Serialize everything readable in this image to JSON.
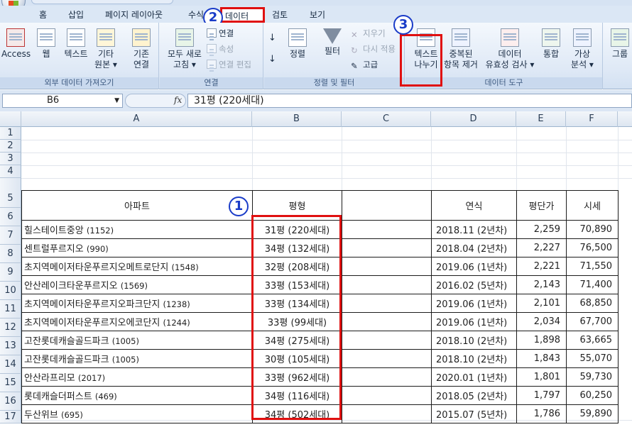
{
  "tabs": [
    {
      "label": "홈"
    },
    {
      "label": "삽입"
    },
    {
      "label": "페이지 레이아웃"
    },
    {
      "label": "수식"
    },
    {
      "label": "데이터"
    },
    {
      "label": "검토"
    },
    {
      "label": "보기"
    }
  ],
  "ribbon": {
    "external": {
      "label": "외부 데이터 가져오기",
      "access": "Access",
      "web": "웹",
      "text": "텍스트",
      "other1": "기타",
      "other2": "원본 ▾",
      "existing1": "기존",
      "existing2": "연결"
    },
    "connections": {
      "label": "연결",
      "refresh1": "모두 새로",
      "refresh2": "고침 ▾",
      "connections": "연결",
      "properties": "속성",
      "edit_links": "연결 편집"
    },
    "sort_filter": {
      "label": "정렬 및 필터",
      "sort": "정렬",
      "filter": "필터",
      "clear": "지우기",
      "reapply": "다시 적용",
      "advanced": "고급"
    },
    "data_tools": {
      "label": "데이터 도구",
      "text_to_columns1": "텍스트",
      "text_to_columns2": "나누기",
      "remove_dup1": "중복된",
      "remove_dup2": "항목 제거",
      "validation1": "데이터",
      "validation2": "유효성 검사 ▾",
      "consolidate": "통합",
      "whatif1": "가상",
      "whatif2": "분석 ▾"
    },
    "outline": {
      "group": "그룹"
    }
  },
  "annotations": {
    "n1": "1",
    "n2": "2",
    "n3": "3"
  },
  "formula_bar": {
    "name_box": "B6",
    "fx": "fx",
    "value": "31평 (220세대)"
  },
  "columns": [
    "A",
    "B",
    "C",
    "D",
    "E",
    "F"
  ],
  "rows": [
    "1",
    "2",
    "3",
    "4",
    "5",
    "6",
    "7",
    "8",
    "9",
    "10",
    "11",
    "12",
    "13",
    "14",
    "15",
    "16",
    "17"
  ],
  "table": {
    "headers": {
      "apt": "아파트",
      "size": "평형",
      "blank": "",
      "year": "연식",
      "price_per": "평단가",
      "market": "시세"
    },
    "rows": [
      {
        "apt": "힐스테이트중앙",
        "cnt": "(1152)",
        "size": "31평 (220세대)",
        "year": "2018.11 (2년차)",
        "price_per": "2,259",
        "market": "70,890"
      },
      {
        "apt": "센트럴푸르지오",
        "cnt": "(990)",
        "size": "34평 (132세대)",
        "year": "2018.04 (2년차)",
        "price_per": "2,227",
        "market": "76,500"
      },
      {
        "apt": "초지역메이저타운푸르지오메트로단지",
        "cnt": "(1548)",
        "size": "32평 (208세대)",
        "year": "2019.06 (1년차)",
        "price_per": "2,221",
        "market": "71,550"
      },
      {
        "apt": "안산레이크타운푸르지오",
        "cnt": "(1569)",
        "size": "33평 (153세대)",
        "year": "2016.02 (5년차)",
        "price_per": "2,143",
        "market": "71,400"
      },
      {
        "apt": "초지역메이저타운푸르지오파크단지",
        "cnt": "(1238)",
        "size": "33평 (134세대)",
        "year": "2019.06 (1년차)",
        "price_per": "2,101",
        "market": "68,850"
      },
      {
        "apt": "초지역메이저타운푸르지오에코단지",
        "cnt": "(1244)",
        "size": "33평 (99세대)",
        "year": "2019.06 (1년차)",
        "price_per": "2,034",
        "market": "67,700"
      },
      {
        "apt": "고잔롯데캐슬골드파크",
        "cnt": "(1005)",
        "size": "34평 (275세대)",
        "year": "2018.10 (2년차)",
        "price_per": "1,898",
        "market": "63,665"
      },
      {
        "apt": "고잔롯데캐슬골드파크",
        "cnt": "(1005)",
        "size": "30평 (105세대)",
        "year": "2018.10 (2년차)",
        "price_per": "1,843",
        "market": "55,070"
      },
      {
        "apt": "안산라프리모",
        "cnt": "(2017)",
        "size": "33평 (962세대)",
        "year": "2020.01 (1년차)",
        "price_per": "1,801",
        "market": "59,730"
      },
      {
        "apt": "롯데캐슬더퍼스트",
        "cnt": "(469)",
        "size": "34평 (116세대)",
        "year": "2018.05 (2년차)",
        "price_per": "1,797",
        "market": "60,250"
      },
      {
        "apt": "두산위브",
        "cnt": "(695)",
        "size": "34평 (502세대)",
        "year": "2015.07 (5년차)",
        "price_per": "1,786",
        "market": "59,890"
      }
    ]
  },
  "colors": {
    "highlight": "#e01010",
    "annotation": "#1a3cc8"
  }
}
